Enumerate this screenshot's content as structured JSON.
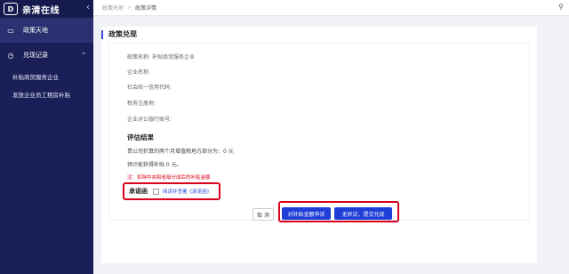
{
  "sidebar": {
    "brand": "亲清在线",
    "collapse_icon": "chevron-left-icon",
    "items": [
      {
        "label": "政策天地",
        "icon": "document-icon",
        "active": true
      },
      {
        "label": "兑现记录",
        "icon": "clock-icon",
        "expanded": true
      }
    ],
    "sub_items": [
      {
        "label": "补贴商贸服务企业"
      },
      {
        "label": "发放企业员工租房补贴"
      }
    ]
  },
  "topbar": {
    "breadcrumb": [
      "政策天地",
      "政策详情"
    ],
    "separator": ">"
  },
  "main": {
    "section_title": "政策兑现",
    "fields": [
      {
        "label": "政策名称:",
        "value": "补贴商贸服务企业"
      },
      {
        "label": "企业名称:",
        "value": ""
      },
      {
        "label": "社会统一信用代码:",
        "value": ""
      },
      {
        "label": "税务注册地:",
        "value": ""
      },
      {
        "label": "企业对公银行账号:",
        "value": ""
      }
    ],
    "eval_title": "评估结果",
    "calc_lines": [
      "贵公司折算的两个月增值税地方部分为：0 元",
      "预计能获得补贴 0 元。"
    ],
    "note": "注：扣除中央和省级分成后的补贴金额",
    "promise": {
      "label": "承诺函",
      "link": "阅读并签署《承诺函》"
    },
    "buttons": {
      "cancel": "取 消",
      "apply": "对补贴金额申诉",
      "submit": "无异议，提交兑现"
    }
  },
  "colors": {
    "sidebar_bg": "#1a2057",
    "primary": "#1f3ed8",
    "highlight": "#d9001b"
  }
}
